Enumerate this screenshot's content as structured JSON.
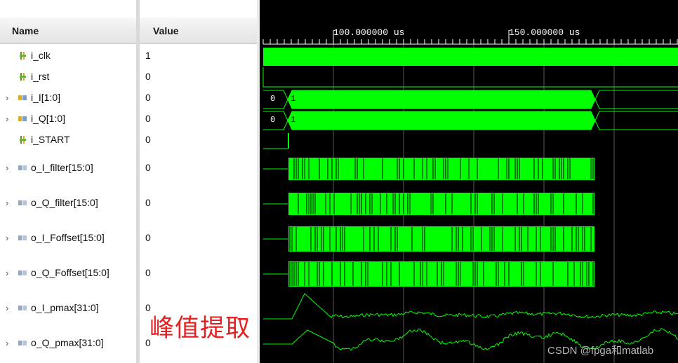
{
  "headers": {
    "name": "Name",
    "value": "Value"
  },
  "signals": [
    {
      "name": "i_clk",
      "value": "1",
      "kind": "bit"
    },
    {
      "name": "i_rst",
      "value": "0",
      "kind": "bit"
    },
    {
      "name": "i_I[1:0]",
      "value": "0",
      "kind": "bus"
    },
    {
      "name": "i_Q[1:0]",
      "value": "0",
      "kind": "bus"
    },
    {
      "name": "i_START",
      "value": "0",
      "kind": "bit"
    },
    {
      "name": "o_I_filter[15:0]",
      "value": "0",
      "kind": "bus"
    },
    {
      "name": "o_Q_filter[15:0]",
      "value": "0",
      "kind": "bus"
    },
    {
      "name": "o_I_Foffset[15:0]",
      "value": "0",
      "kind": "bus"
    },
    {
      "name": "o_Q_Foffset[15:0]",
      "value": "0",
      "kind": "bus"
    },
    {
      "name": "o_I_pmax[31:0]",
      "value": "0",
      "kind": "bus"
    },
    {
      "name": "o_Q_pmax[31:0]",
      "value": "0",
      "kind": "bus"
    }
  ],
  "timeline": {
    "marker1": "100.000000 us",
    "marker2": "150.000000 us"
  },
  "bus_values": {
    "start": "0",
    "after": "1"
  },
  "annotation": "峰值提取",
  "watermark": "CSDN @fpga和matlab",
  "colors": {
    "wave": "#00ff00",
    "annotation": "#e52020",
    "background": "#000000"
  },
  "icons": {
    "bit": "bit-signal-icon",
    "bus": "bus-signal-icon",
    "expand": "chevron-right-icon"
  }
}
